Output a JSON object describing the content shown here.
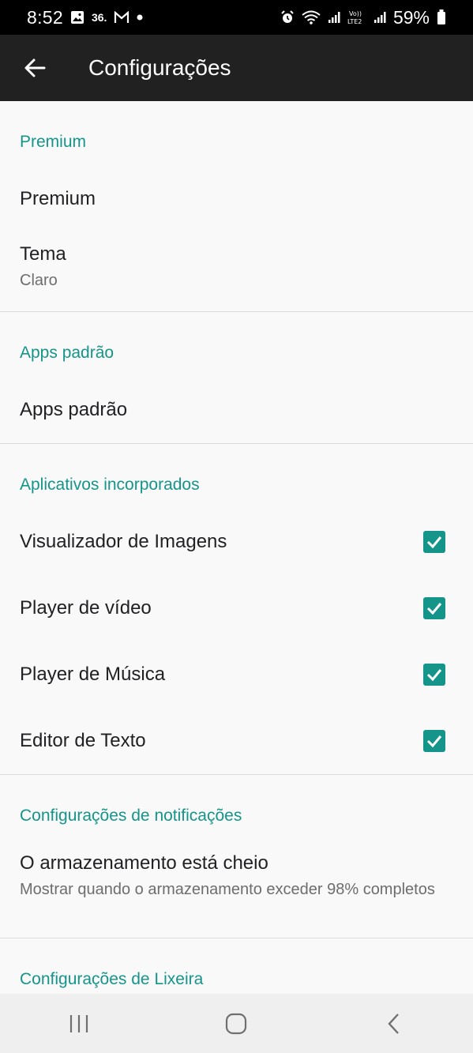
{
  "status": {
    "time": "8:52",
    "notif_temp": "36.",
    "battery": "59%"
  },
  "appbar": {
    "title": "Configurações"
  },
  "sections": {
    "premium": {
      "header": "Premium",
      "premium_label": "Premium",
      "theme_label": "Tema",
      "theme_value": "Claro"
    },
    "default_apps": {
      "header": "Apps padrão",
      "item_label": "Apps padrão"
    },
    "builtin": {
      "header": "Aplicativos incorporados",
      "items": [
        {
          "label": "Visualizador de Imagens",
          "checked": true
        },
        {
          "label": "Player de vídeo",
          "checked": true
        },
        {
          "label": "Player de Música",
          "checked": true
        },
        {
          "label": "Editor de Texto",
          "checked": true
        }
      ]
    },
    "notifications": {
      "header": "Configurações de notificações",
      "storage_title": "O armazenamento está cheio",
      "storage_desc": "Mostrar quando o armazenamento exceder 98% completos"
    },
    "trash": {
      "header": "Configurações de Lixeira"
    }
  },
  "colors": {
    "accent": "#15958a",
    "appbar": "#212121",
    "background": "#f9f9f9"
  }
}
